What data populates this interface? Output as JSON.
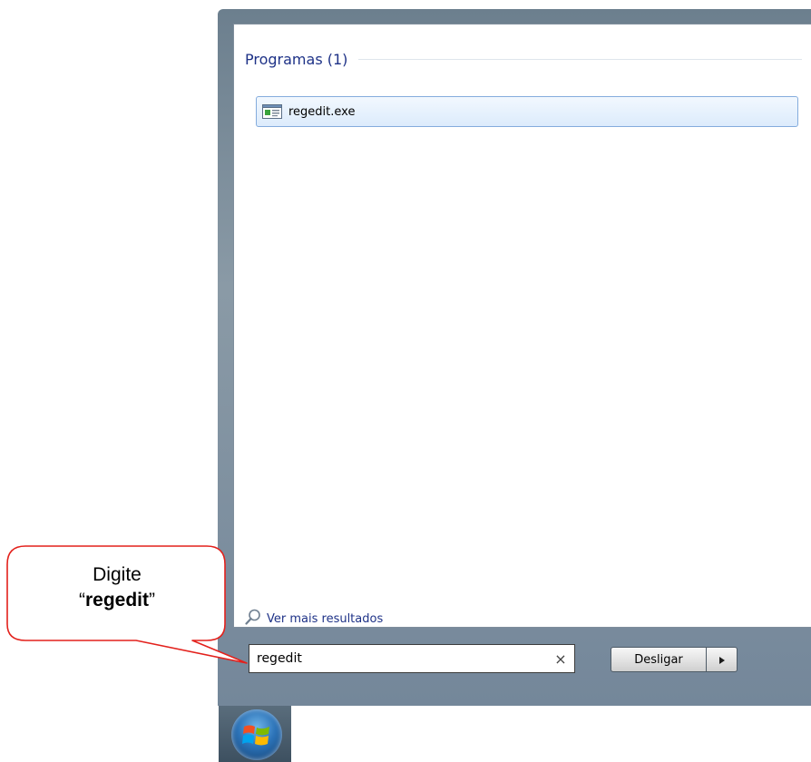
{
  "results": {
    "section_title": "Programas (1)",
    "items": [
      {
        "label": "regedit.exe",
        "icon": "registry-editor-icon"
      }
    ],
    "more_results_label": "Ver mais resultados"
  },
  "search": {
    "value": "regedit",
    "clear_glyph": "×"
  },
  "shutdown": {
    "label": "Desligar",
    "arrow_glyph": "▸"
  },
  "callout": {
    "line1": "Digite",
    "quote_open": "“",
    "keyword": "regedit",
    "quote_close": "”"
  },
  "colors": {
    "accent_text": "#1e3287",
    "selection_border": "#84acdd",
    "callout_border": "#e3211c"
  }
}
